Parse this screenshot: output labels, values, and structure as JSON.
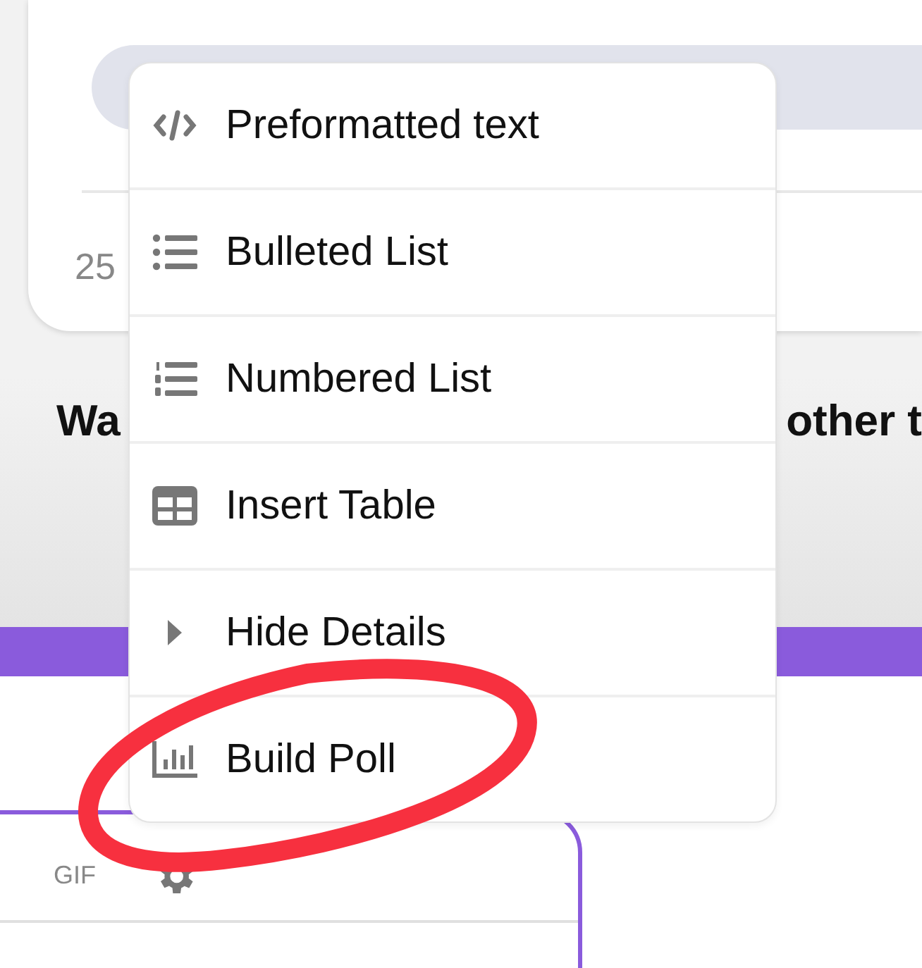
{
  "post_card": {
    "count": "25"
  },
  "heading": {
    "left": "Wa",
    "right": "other t"
  },
  "editor_toolbar": {
    "gif": "GIF"
  },
  "menu": {
    "items": [
      {
        "label": "Preformatted text",
        "kind": "code"
      },
      {
        "label": "Bulleted List",
        "kind": "bullets"
      },
      {
        "label": "Numbered List",
        "kind": "numbers"
      },
      {
        "label": "Insert Table",
        "kind": "table"
      },
      {
        "label": "Hide Details",
        "kind": "details"
      },
      {
        "label": "Build Poll",
        "kind": "poll"
      }
    ]
  }
}
